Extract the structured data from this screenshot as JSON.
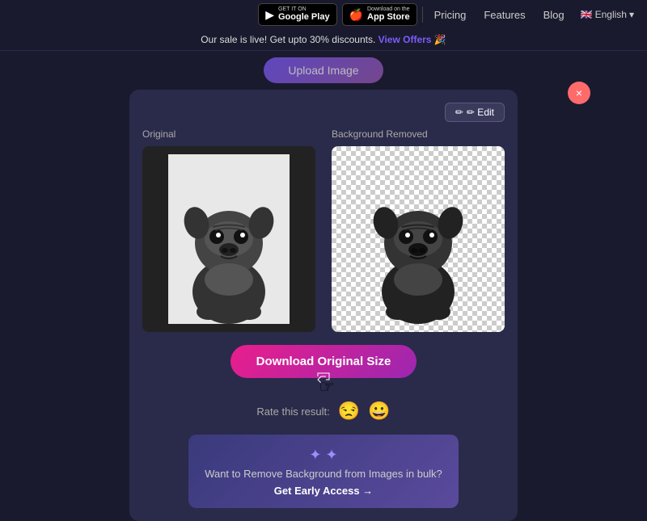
{
  "nav": {
    "google_play_top_text": "GET IT ON",
    "google_play_main_text": "Google Play",
    "app_store_top_text": "Download on the",
    "app_store_main_text": "App Store",
    "pricing_label": "Pricing",
    "features_label": "Features",
    "blog_label": "Blog",
    "lang_label": "English",
    "flag_emoji": "🇬🇧"
  },
  "sale_banner": {
    "text": "Our sale is live! Get upto 30% discounts.",
    "cta_text": "View Offers 🎉"
  },
  "upload": {
    "button_label": "Upload Image"
  },
  "main": {
    "close_icon": "×",
    "original_label": "Original",
    "bg_removed_label": "Background Removed",
    "edit_label": "✏ Edit",
    "download_label": "Download Original Size",
    "rating_text": "Rate this result:",
    "rating_bad_emoji": "😒",
    "rating_good_emoji": "😀"
  },
  "bulk_cta": {
    "icon": "✦",
    "text": "Want to Remove Background from Images in bulk?",
    "link_text": "Get Early Access →"
  },
  "colors": {
    "bg_dark": "#1a1a2e",
    "bg_card": "#2a2a4a",
    "accent_purple": "#7c5cfc",
    "accent_pink": "#e91e8c",
    "close_red": "#ff6b6b"
  }
}
